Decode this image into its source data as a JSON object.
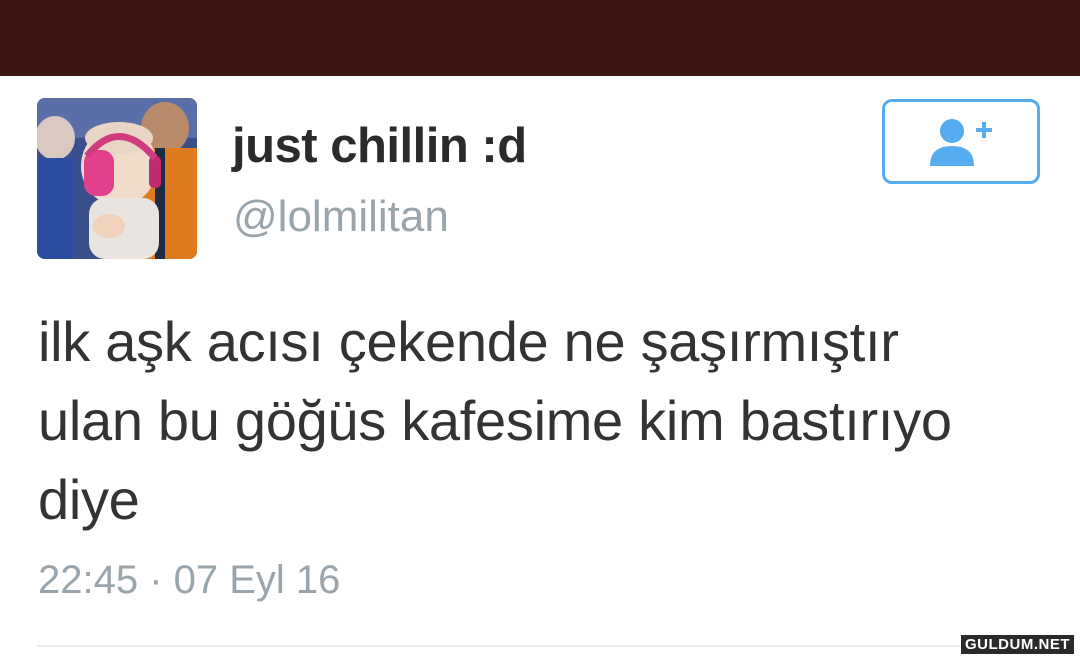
{
  "header": {
    "bar_color": "#3b1510"
  },
  "tweet": {
    "avatar_icon": "profile-photo-baby-with-pink-earmuffs",
    "display_name": "just chillin :d",
    "handle": "@lolmilitan",
    "follow_icon": "add-user-icon",
    "text": "ilk aşk acısı çekende ne şaşırmıştır\nulan bu göğüs kafesime kim bastırıyo\ndiye",
    "timestamp": "22:45 · 07 Eyl 16"
  },
  "watermark": {
    "text": "GULDUM.NET"
  },
  "colors": {
    "accent": "#55acee",
    "name_text": "#2b2b2b",
    "muted_text": "#9aa4ab",
    "body_text": "#333333"
  }
}
